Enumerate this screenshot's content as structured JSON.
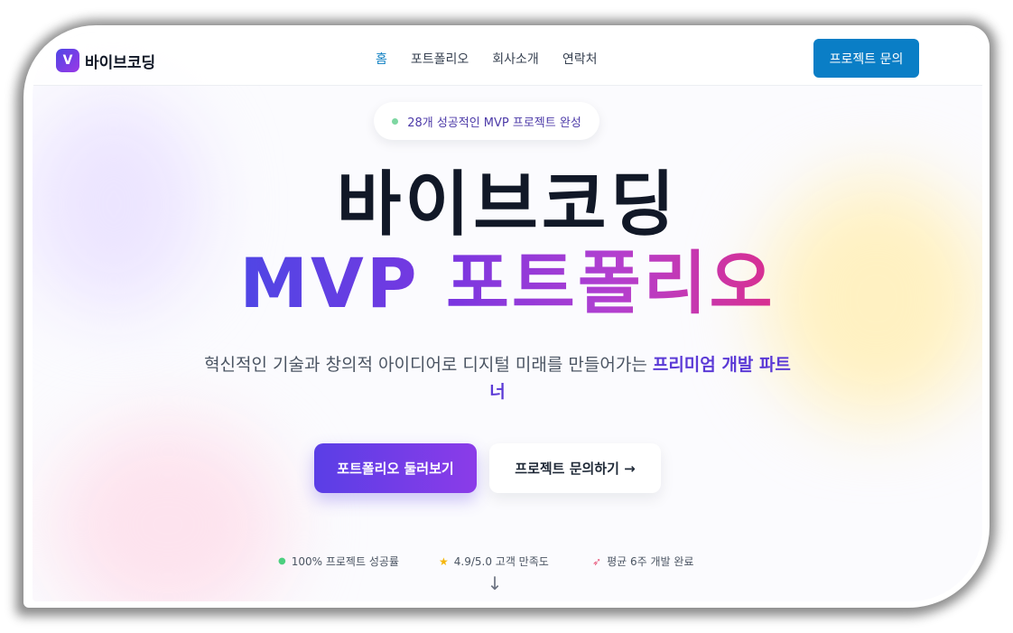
{
  "brand": {
    "logo_letter": "V",
    "name": "바이브코딩"
  },
  "nav": {
    "links": [
      "홈",
      "포트폴리오",
      "회사소개",
      "연락처"
    ],
    "active_index": 0,
    "cta": "프로젝트 문의"
  },
  "hero": {
    "badge": "28개 성공적인 MVP 프로젝트 완성",
    "title_line1": "바이브코딩",
    "title_line2": "MVP 포트폴리오",
    "subtitle_plain": "혁신적인 기술과 창의적 아이디어로 디지털 미래를 만들어가는 ",
    "subtitle_emphasis": "프리미엄 개발 파트너",
    "primary_button": "포트폴리오 둘러보기",
    "secondary_button": "프로젝트 문의하기 →"
  },
  "stats": [
    {
      "icon": "green-dot-icon",
      "text": "100% 프로젝트 성공률"
    },
    {
      "icon": "star-icon",
      "text": "4.9/5.0 고객 만족도"
    },
    {
      "icon": "rocket-icon",
      "text": "평균 6주 개발 완료"
    }
  ],
  "scroll_indicator": "↓",
  "colors": {
    "accent": "#0a7ec6",
    "gradient_start": "#4f46e5",
    "gradient_end": "#d92f8f",
    "title": "#111827"
  }
}
